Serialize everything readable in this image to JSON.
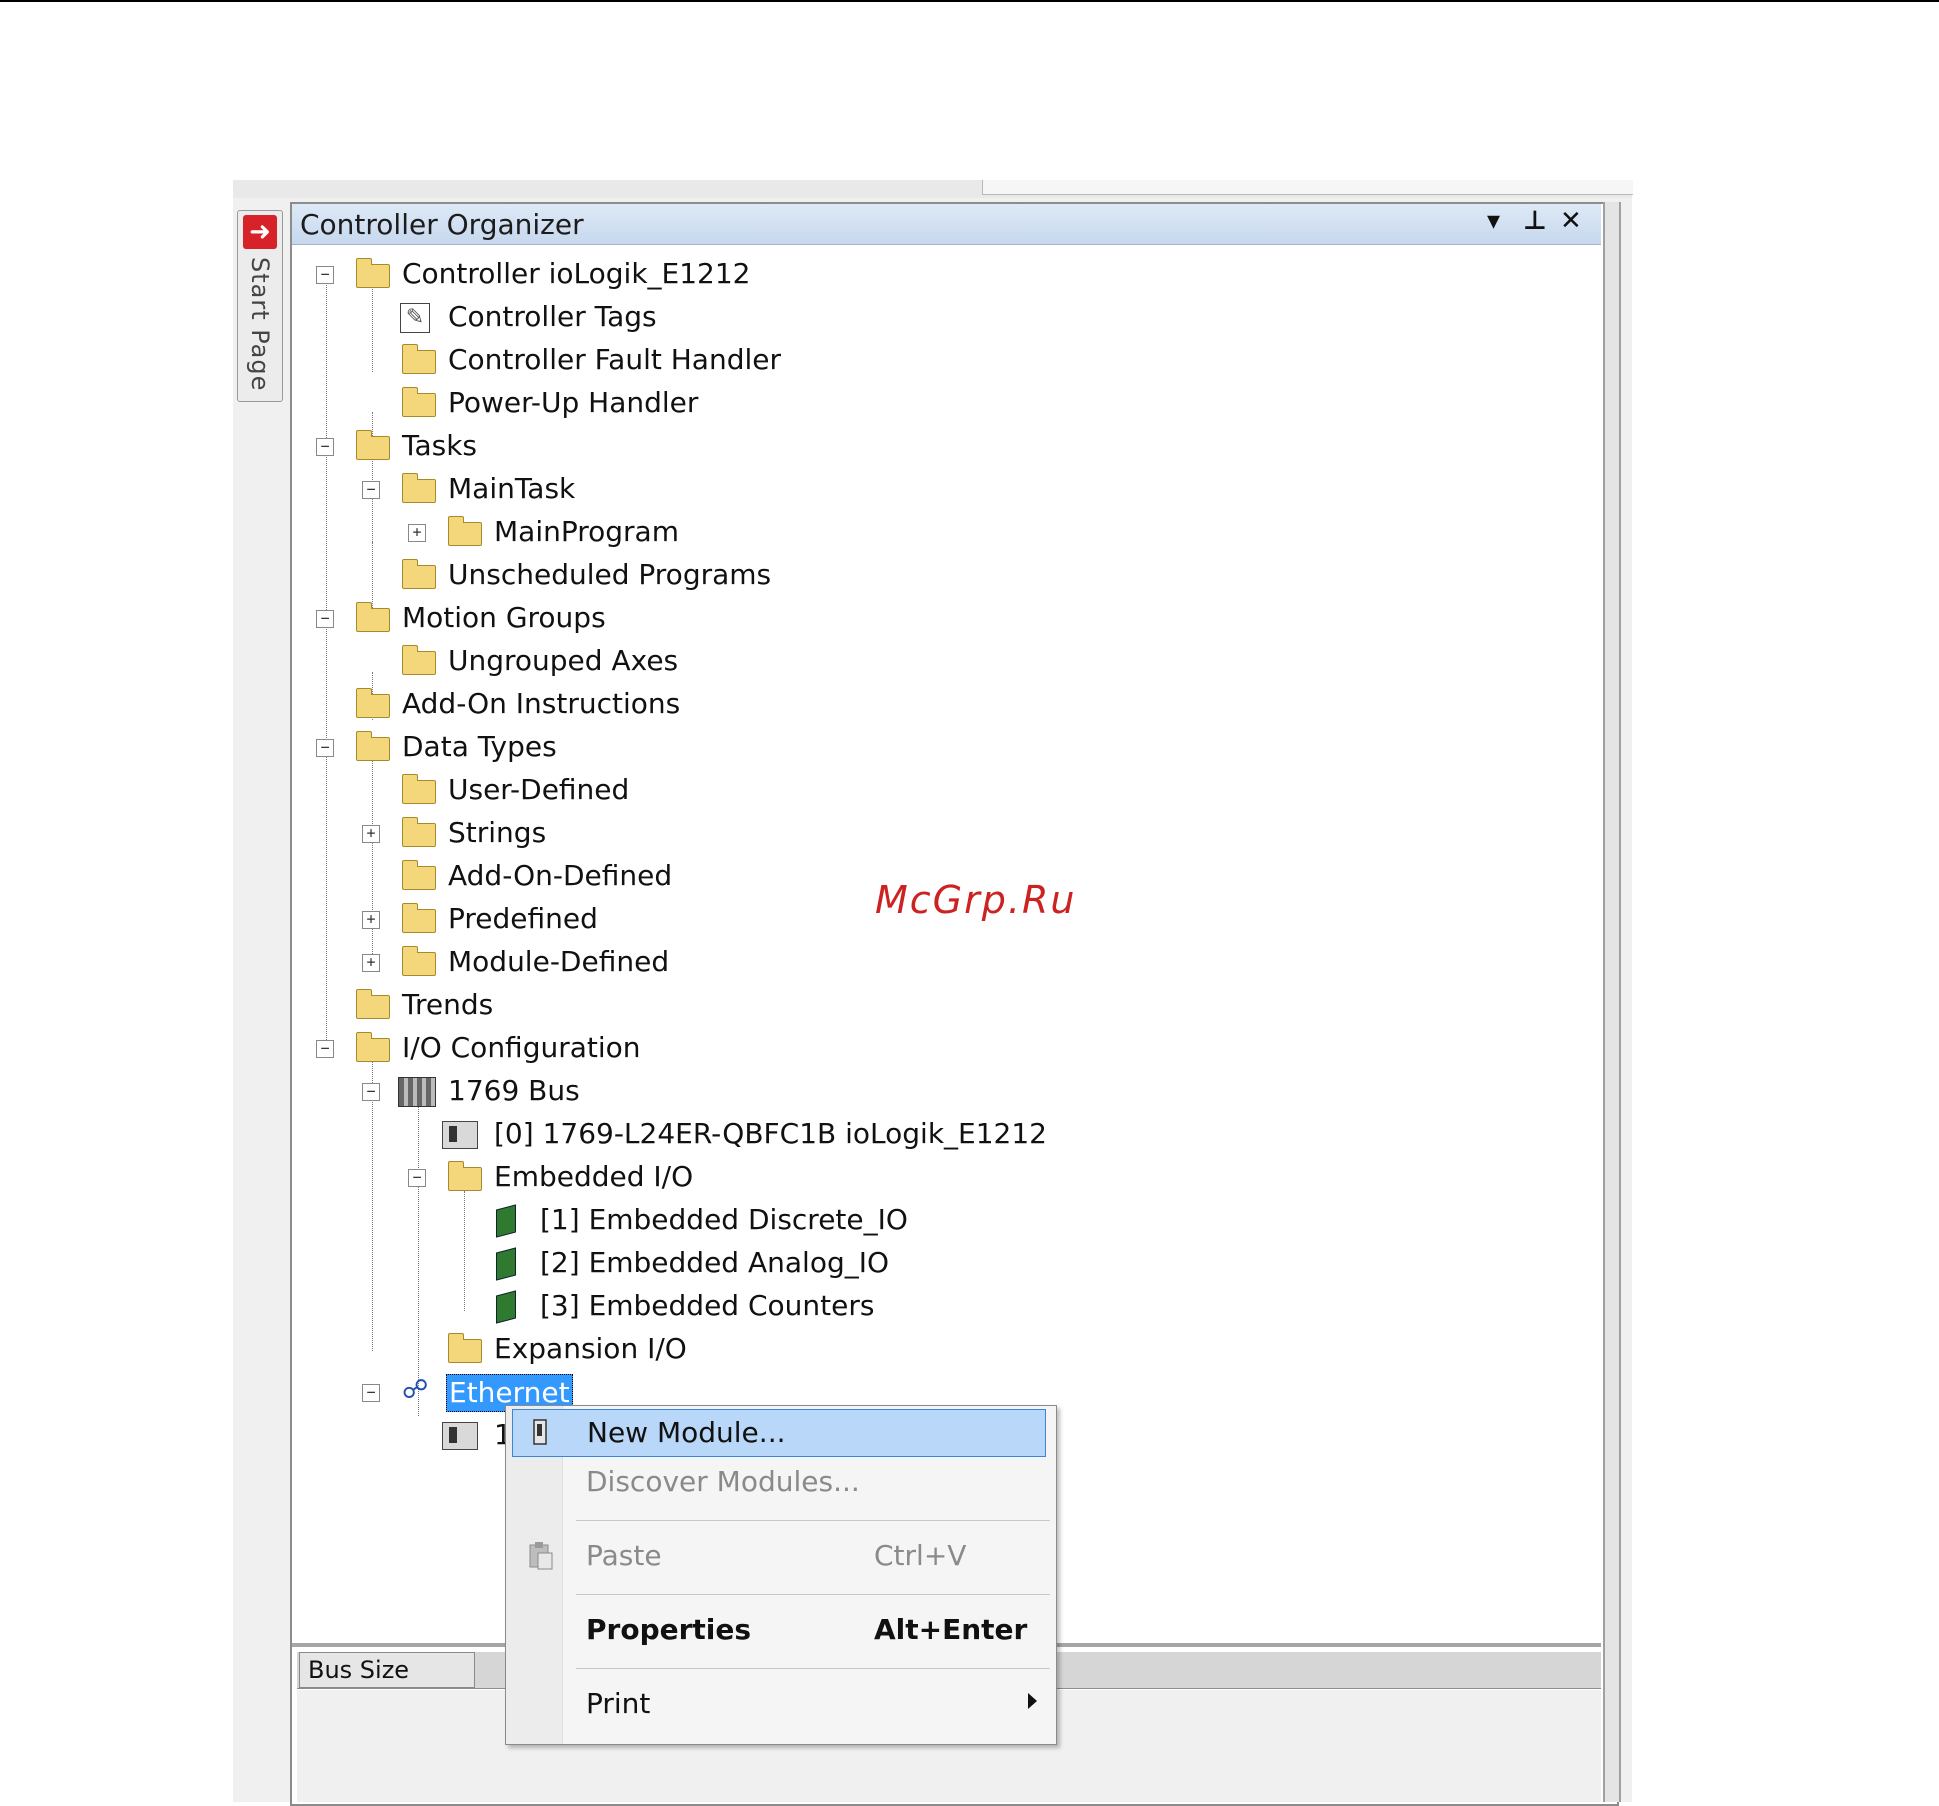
{
  "window": {
    "side_tab_label": "Start Page",
    "panel_title": "Controller Organizer",
    "controls": {
      "dropdown": "▾",
      "pin": "⊥",
      "close": "✕"
    }
  },
  "tree": {
    "controller": "Controller ioLogik_E1212",
    "controller_tags": "Controller Tags",
    "controller_fault_handler": "Controller Fault Handler",
    "power_up_handler": "Power-Up Handler",
    "tasks": "Tasks",
    "main_task": "MainTask",
    "main_program": "MainProgram",
    "unscheduled_programs": "Unscheduled Programs",
    "motion_groups": "Motion Groups",
    "ungrouped_axes": "Ungrouped Axes",
    "add_on_instructions": "Add-On Instructions",
    "data_types": "Data Types",
    "user_defined": "User-Defined",
    "strings": "Strings",
    "add_on_defined": "Add-On-Defined",
    "predefined": "Predefined",
    "module_defined": "Module-Defined",
    "trends": "Trends",
    "io_configuration": "I/O Configuration",
    "bus_1769": "1769 Bus",
    "controller_module": "[0] 1769-L24ER-QBFC1B ioLogik_E1212",
    "embedded_io": "Embedded I/O",
    "embedded_discrete": "[1] Embedded Discrete_IO",
    "embedded_analog": "[2] Embedded Analog_IO",
    "embedded_counters": "[3] Embedded Counters",
    "expansion_io": "Expansion I/O",
    "ethernet": "Ethernet",
    "ethernet_child_partial": "1"
  },
  "lower_grid": {
    "column_1": "Bus Size"
  },
  "watermark": "McGrp.Ru",
  "context_menu": {
    "new_module": "New Module...",
    "discover_modules": "Discover Modules...",
    "paste": "Paste",
    "paste_shortcut": "Ctrl+V",
    "properties": "Properties",
    "properties_shortcut": "Alt+Enter",
    "print": "Print"
  },
  "colors": {
    "selection": "#3399ff",
    "menu_highlight": "#b9d7f8",
    "title_gradient_top": "#dde9f6",
    "watermark": "#cc2222"
  }
}
